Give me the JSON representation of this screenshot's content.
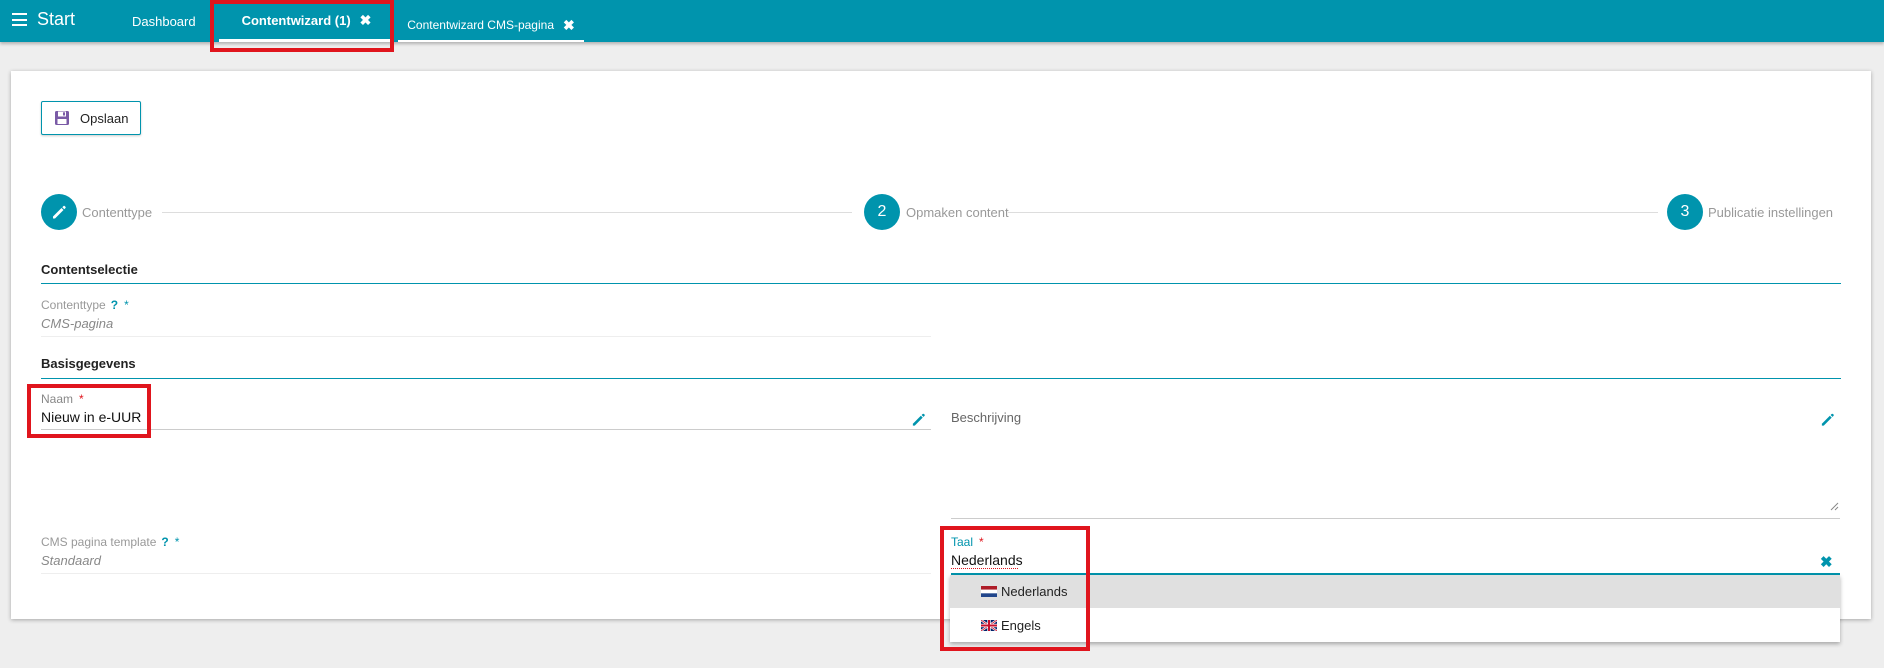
{
  "topbar": {
    "start_label": "Start",
    "tabs": [
      {
        "label": "Dashboard",
        "closable": false
      },
      {
        "label": "Contentwizard (1)",
        "closable": true,
        "active": true
      },
      {
        "label": "Contentwizard CMS-pagina",
        "closable": true
      }
    ],
    "close_glyph": "✖"
  },
  "toolbar": {
    "save_label": "Opslaan",
    "save_icon": "floppy-disk-icon"
  },
  "stepper": {
    "steps": [
      {
        "marker": "pencil-icon",
        "label": "Contenttype"
      },
      {
        "marker": "2",
        "label": "Opmaken content"
      },
      {
        "marker": "3",
        "label": "Publicatie instellingen"
      }
    ]
  },
  "sections": {
    "contentselectie": "Contentselectie",
    "basisgegevens": "Basisgegevens"
  },
  "fields": {
    "contenttype": {
      "label": "Contenttype",
      "help": "?",
      "required_mark": "*",
      "value": "CMS-pagina"
    },
    "naam": {
      "label": "Naam",
      "required_mark": "*",
      "value": "Nieuw in e-UUR"
    },
    "beschrijving": {
      "label": "Beschrijving",
      "value": ""
    },
    "cms_template": {
      "label": "CMS pagina template",
      "help": "?",
      "required_mark": "*",
      "value": "Standaard"
    },
    "taal": {
      "label": "Taal",
      "required_mark": "*",
      "value": "Nederlands",
      "clear_glyph": "✖",
      "options": [
        {
          "label": "Nederlands",
          "flag": "flag-nl-icon",
          "selected": true
        },
        {
          "label": "Engels",
          "flag": "flag-gb-icon",
          "selected": false
        }
      ]
    }
  },
  "colors": {
    "accent": "#0094ad",
    "required": "#e0151d",
    "highlight": "#e0151d"
  }
}
